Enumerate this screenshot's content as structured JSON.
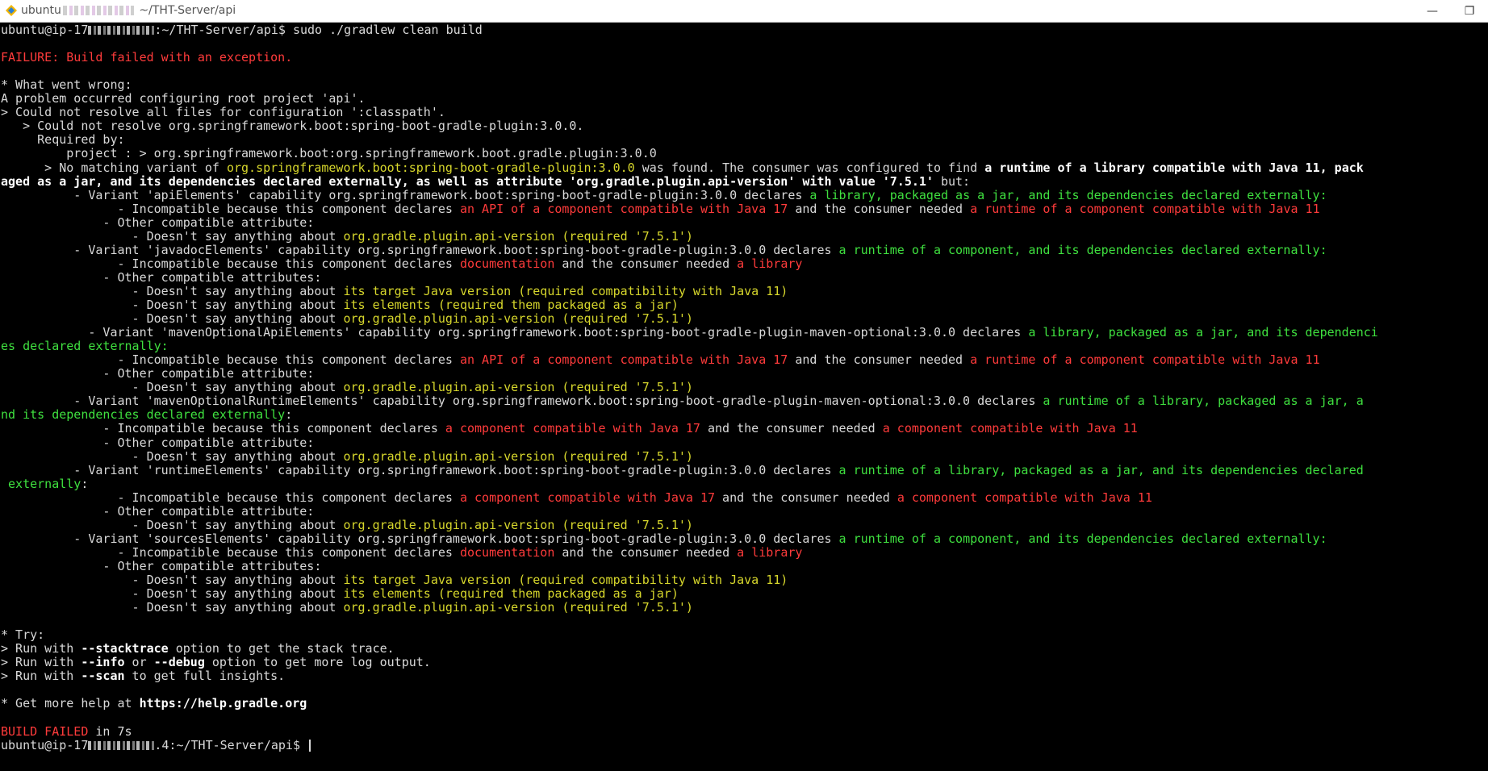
{
  "window": {
    "title_prefix": "ubuntu",
    "title_path": " ~/THT-Server/api",
    "controls": {
      "minimize": "—",
      "maximize": "❐"
    }
  },
  "terminal": {
    "colors": {
      "bg": "#000000",
      "fg": "#d9d9d9",
      "green": "#3fe03f",
      "yellow": "#d7d72c",
      "red": "#ff3b3b"
    },
    "lines": [
      [
        {
          "t": "ubuntu@ip-17"
        },
        {
          "mask": true
        },
        {
          "t": ":~/THT-Server/api$ sudo ./gradlew clean build"
        }
      ],
      [],
      [
        {
          "t": "FAILURE: Build failed with an exception.",
          "c": "r"
        }
      ],
      [],
      [
        {
          "t": "* What went wrong:"
        }
      ],
      [
        {
          "t": "A problem occurred configuring root project 'api'."
        }
      ],
      [
        {
          "t": "> Could not resolve all files for configuration ':classpath'."
        }
      ],
      [
        {
          "t": "   > Could not resolve org.springframework.boot:spring-boot-gradle-plugin:3.0.0."
        }
      ],
      [
        {
          "t": "     Required by:"
        }
      ],
      [
        {
          "t": "         project : > org.springframework.boot:org.springframework.boot.gradle.plugin:3.0.0"
        }
      ],
      [
        {
          "t": "      > No matching variant of "
        },
        {
          "t": "org.springframework.boot:spring-boot-gradle-plugin:3.0.0",
          "c": "y"
        },
        {
          "t": " was found. The consumer was configured to find "
        },
        {
          "t": "a runtime of a library compatible with Java 11, pack",
          "c": "b"
        }
      ],
      [
        {
          "t": "aged as a jar, and its dependencies declared externally, as well as attribute 'org.gradle.plugin.api-version' with value '7.5.1'",
          "c": "b"
        },
        {
          "t": " but:"
        }
      ],
      [
        {
          "t": "          - Variant 'apiElements' capability org.springframework.boot:spring-boot-gradle-plugin:3.0.0 declares "
        },
        {
          "t": "a library, packaged as a jar, and its dependencies declared externally:",
          "c": "g"
        }
      ],
      [
        {
          "t": "                - Incompatible because this component declares "
        },
        {
          "t": "an API of a component compatible with Java 17",
          "c": "r"
        },
        {
          "t": " and the consumer needed "
        },
        {
          "t": "a runtime of a component compatible with Java 11",
          "c": "r"
        }
      ],
      [
        {
          "t": "              - Other compatible attribute:"
        }
      ],
      [
        {
          "t": "                  - Doesn't say anything about "
        },
        {
          "t": "org.gradle.plugin.api-version (required '7.5.1')",
          "c": "y"
        }
      ],
      [
        {
          "t": "          - Variant 'javadocElements' capability org.springframework.boot:spring-boot-gradle-plugin:3.0.0 declares "
        },
        {
          "t": "a runtime of a component, and its dependencies declared externally:",
          "c": "g"
        }
      ],
      [
        {
          "t": "                - Incompatible because this component declares "
        },
        {
          "t": "documentation",
          "c": "r"
        },
        {
          "t": " and the consumer needed "
        },
        {
          "t": "a library",
          "c": "r"
        }
      ],
      [
        {
          "t": "              - Other compatible attributes:"
        }
      ],
      [
        {
          "t": "                  - Doesn't say anything about "
        },
        {
          "t": "its target Java version (required compatibility with Java 11)",
          "c": "y"
        }
      ],
      [
        {
          "t": "                  - Doesn't say anything about "
        },
        {
          "t": "its elements (required them packaged as a jar)",
          "c": "y"
        }
      ],
      [
        {
          "t": "                  - Doesn't say anything about "
        },
        {
          "t": "org.gradle.plugin.api-version (required '7.5.1')",
          "c": "y"
        }
      ],
      [
        {
          "t": "            - Variant 'mavenOptionalApiElements' capability org.springframework.boot:spring-boot-gradle-plugin-maven-optional:3.0.0 declares "
        },
        {
          "t": "a library, packaged as a jar, and its dependenci",
          "c": "g"
        }
      ],
      [
        {
          "t": "es declared externally:",
          "c": "g"
        }
      ],
      [
        {
          "t": "                - Incompatible because this component declares "
        },
        {
          "t": "an API of a component compatible with Java 17",
          "c": "r"
        },
        {
          "t": " and the consumer needed "
        },
        {
          "t": "a runtime of a component compatible with Java 11",
          "c": "r"
        }
      ],
      [
        {
          "t": "              - Other compatible attribute:"
        }
      ],
      [
        {
          "t": "                  - Doesn't say anything about "
        },
        {
          "t": "org.gradle.plugin.api-version (required '7.5.1')",
          "c": "y"
        }
      ],
      [
        {
          "t": "          - Variant 'mavenOptionalRuntimeElements' capability org.springframework.boot:spring-boot-gradle-plugin-maven-optional:3.0.0 declares "
        },
        {
          "t": "a runtime of a library, packaged as a jar, a",
          "c": "g"
        }
      ],
      [
        {
          "t": "nd its dependencies declared externally",
          "c": "g"
        },
        {
          "t": ":"
        }
      ],
      [
        {
          "t": "              - Incompatible because this component declares "
        },
        {
          "t": "a component compatible with Java 17",
          "c": "r"
        },
        {
          "t": " and the consumer needed "
        },
        {
          "t": "a component compatible with Java 11",
          "c": "r"
        }
      ],
      [
        {
          "t": "              - Other compatible attribute:"
        }
      ],
      [
        {
          "t": "                  - Doesn't say anything about "
        },
        {
          "t": "org.gradle.plugin.api-version (required '7.5.1')",
          "c": "y"
        }
      ],
      [
        {
          "t": "          - Variant 'runtimeElements' capability org.springframework.boot:spring-boot-gradle-plugin:3.0.0 declares "
        },
        {
          "t": "a runtime of a library, packaged as a jar, and its dependencies declared",
          "c": "g"
        }
      ],
      [
        {
          "t": " externally",
          "c": "g"
        },
        {
          "t": ":"
        }
      ],
      [
        {
          "t": "                - Incompatible because this component declares "
        },
        {
          "t": "a component compatible with Java 17",
          "c": "r"
        },
        {
          "t": " and the consumer needed "
        },
        {
          "t": "a component compatible with Java 11",
          "c": "r"
        }
      ],
      [
        {
          "t": "              - Other compatible attribute:"
        }
      ],
      [
        {
          "t": "                  - Doesn't say anything about "
        },
        {
          "t": "org.gradle.plugin.api-version (required '7.5.1')",
          "c": "y"
        }
      ],
      [
        {
          "t": "          - Variant 'sourcesElements' capability org.springframework.boot:spring-boot-gradle-plugin:3.0.0 declares "
        },
        {
          "t": "a runtime of a component, and its dependencies declared externally:",
          "c": "g"
        }
      ],
      [
        {
          "t": "                - Incompatible because this component declares "
        },
        {
          "t": "documentation",
          "c": "r"
        },
        {
          "t": " and the consumer needed "
        },
        {
          "t": "a library",
          "c": "r"
        }
      ],
      [
        {
          "t": "              - Other compatible attributes:"
        }
      ],
      [
        {
          "t": "                  - Doesn't say anything about "
        },
        {
          "t": "its target Java version (required compatibility with Java 11)",
          "c": "y"
        }
      ],
      [
        {
          "t": "                  - Doesn't say anything about "
        },
        {
          "t": "its elements (required them packaged as a jar)",
          "c": "y"
        }
      ],
      [
        {
          "t": "                  - Doesn't say anything about "
        },
        {
          "t": "org.gradle.plugin.api-version (required '7.5.1')",
          "c": "y"
        }
      ],
      [],
      [
        {
          "t": "* Try:"
        }
      ],
      [
        {
          "t": "> Run with "
        },
        {
          "t": "--stacktrace",
          "c": "b"
        },
        {
          "t": " option to get the stack trace."
        }
      ],
      [
        {
          "t": "> Run with "
        },
        {
          "t": "--info",
          "c": "b"
        },
        {
          "t": " or "
        },
        {
          "t": "--debug",
          "c": "b"
        },
        {
          "t": " option to get more log output."
        }
      ],
      [
        {
          "t": "> Run with "
        },
        {
          "t": "--scan",
          "c": "b"
        },
        {
          "t": " to get full insights."
        }
      ],
      [],
      [
        {
          "t": "* Get more help at "
        },
        {
          "t": "https://help.gradle.org",
          "c": "b"
        }
      ],
      [],
      [
        {
          "t": "BUILD FAILED",
          "c": "r"
        },
        {
          "t": " in 7s"
        }
      ],
      [
        {
          "t": "ubuntu@ip-17"
        },
        {
          "mask": true
        },
        {
          "t": ".4:~/THT-Server/api$ "
        },
        {
          "cursor": true
        }
      ]
    ]
  }
}
